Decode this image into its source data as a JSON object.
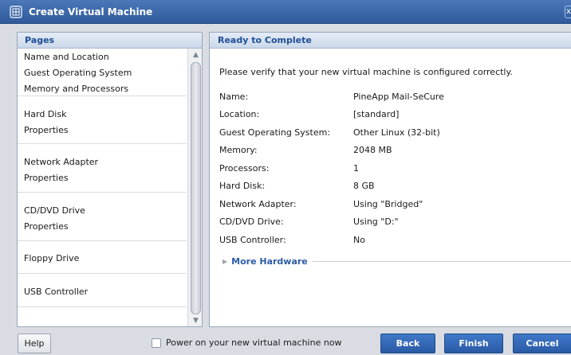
{
  "window": {
    "title": "Create Virtual Machine",
    "app_icon": "vm-icon",
    "partial_button": "x"
  },
  "sidebar": {
    "header": "Pages",
    "groups": [
      {
        "items": [
          "Name and Location",
          "Guest Operating System",
          "Memory and Processors"
        ]
      },
      {
        "items": [
          "Hard Disk",
          "Properties"
        ]
      },
      {
        "items": [
          "Network Adapter",
          "Properties"
        ]
      },
      {
        "items": [
          "CD/DVD Drive",
          "Properties"
        ]
      },
      {
        "items": [
          "Floppy Drive"
        ]
      },
      {
        "items": [
          "USB Controller"
        ]
      }
    ]
  },
  "main": {
    "header": "Ready to Complete",
    "intro": "Please verify that your new virtual machine is configured correctly.",
    "summary": [
      {
        "label": "Name:",
        "value": "PineApp Mail-SeCure"
      },
      {
        "label": "Location:",
        "value": "[standard]"
      },
      {
        "label": "Guest Operating System:",
        "value": "Other Linux (32-bit)"
      },
      {
        "label": "Memory:",
        "value": "2048 MB"
      },
      {
        "label": "Processors:",
        "value": "1"
      },
      {
        "label": "Hard Disk:",
        "value": "8 GB"
      },
      {
        "label": "Network Adapter:",
        "value": "Using \"Bridged\""
      },
      {
        "label": "CD/DVD Drive:",
        "value": "Using \"D:\""
      },
      {
        "label": "USB Controller:",
        "value": "No"
      }
    ],
    "more_hardware": "More Hardware"
  },
  "footer": {
    "help": "Help",
    "power_on_label": "Power on your new virtual machine now",
    "power_on_checked": false,
    "back": "Back",
    "finish": "Finish",
    "cancel": "Cancel"
  },
  "colors": {
    "title_bar": "#2f5a9c",
    "panel_header_text": "#1e4d94",
    "primary_button": "#2a5aa6"
  }
}
